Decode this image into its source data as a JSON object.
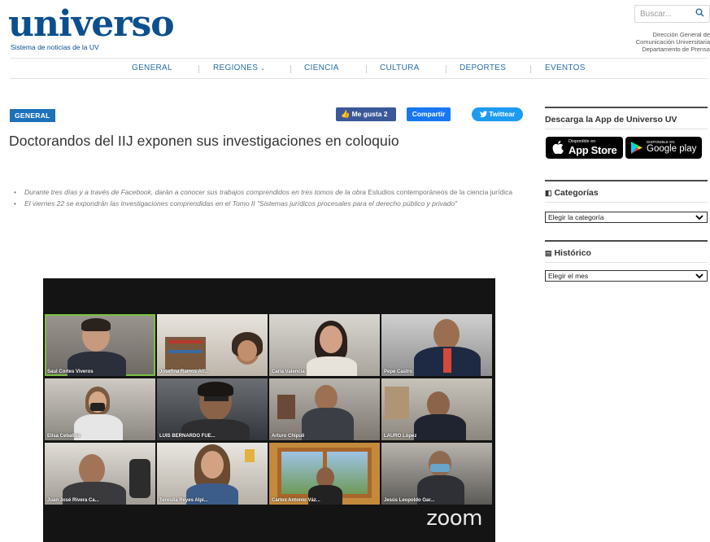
{
  "header": {
    "logo_text": "universo",
    "logo_subtitle": "Sistema de noticias de la UV",
    "search_placeholder": "Buscar...",
    "dept": [
      "Dirección General de",
      "Comunicación Universitaria",
      "Departamento de Prensa"
    ]
  },
  "nav": {
    "items": [
      "GENERAL",
      "REGIONES",
      "CIENCIA",
      "CULTURA",
      "DEPORTES",
      "EVENTOS"
    ]
  },
  "article": {
    "category": "GENERAL",
    "like_label": "Me gusta 2",
    "share_label": "Compartir",
    "tweet_label": "Twittear",
    "title": "Doctorandos del IIJ exponen sus investigaciones en coloquio",
    "bullet1_a": "Durante tres días y a través de Facebook, darán a conocer sus trabajos comprendidos en tres tomos de la obra ",
    "bullet1_b": "Estudios contemporáneos de la ciencia jurídica",
    "bullet2": "El viernes 22 se expondrán las investigaciones comprendidas en el Tomo II \"Sistemas jurídicos procesales para el derecho público y privado\""
  },
  "video": {
    "participants": [
      "Saul Cortes Viveros",
      "Josefina Ramos Alf...",
      "Carla Valencia",
      "Pepe Castro",
      "Elisa Ceballos",
      "LUIS BERNARDO FUE...",
      "Arturo Chipuli",
      "LAURO López",
      "Juan José Rivera Ca...",
      "Teresita Reyes Alpi...",
      "Carlos Antonio Váz...",
      "Jesús Leopoldo Gar..."
    ],
    "brand": "zoom"
  },
  "sidebar": {
    "app_title": "Descarga la App de Universo UV",
    "appstore_small": "Disponible en",
    "appstore_big": "App Store",
    "gplay_small": "DISPONIBLE EN",
    "gplay_big": "Google play",
    "categories_title": "Categorías",
    "categories_select": "Elegir la categoría",
    "history_title": "Histórico",
    "history_select": "Elegir el mes"
  },
  "colors": {
    "brand": "#0c4f8e",
    "badge": "#1c71b9",
    "facebook": "#3b5998",
    "twitter": "#1d9bf0",
    "active_speaker": "#7ac143"
  }
}
